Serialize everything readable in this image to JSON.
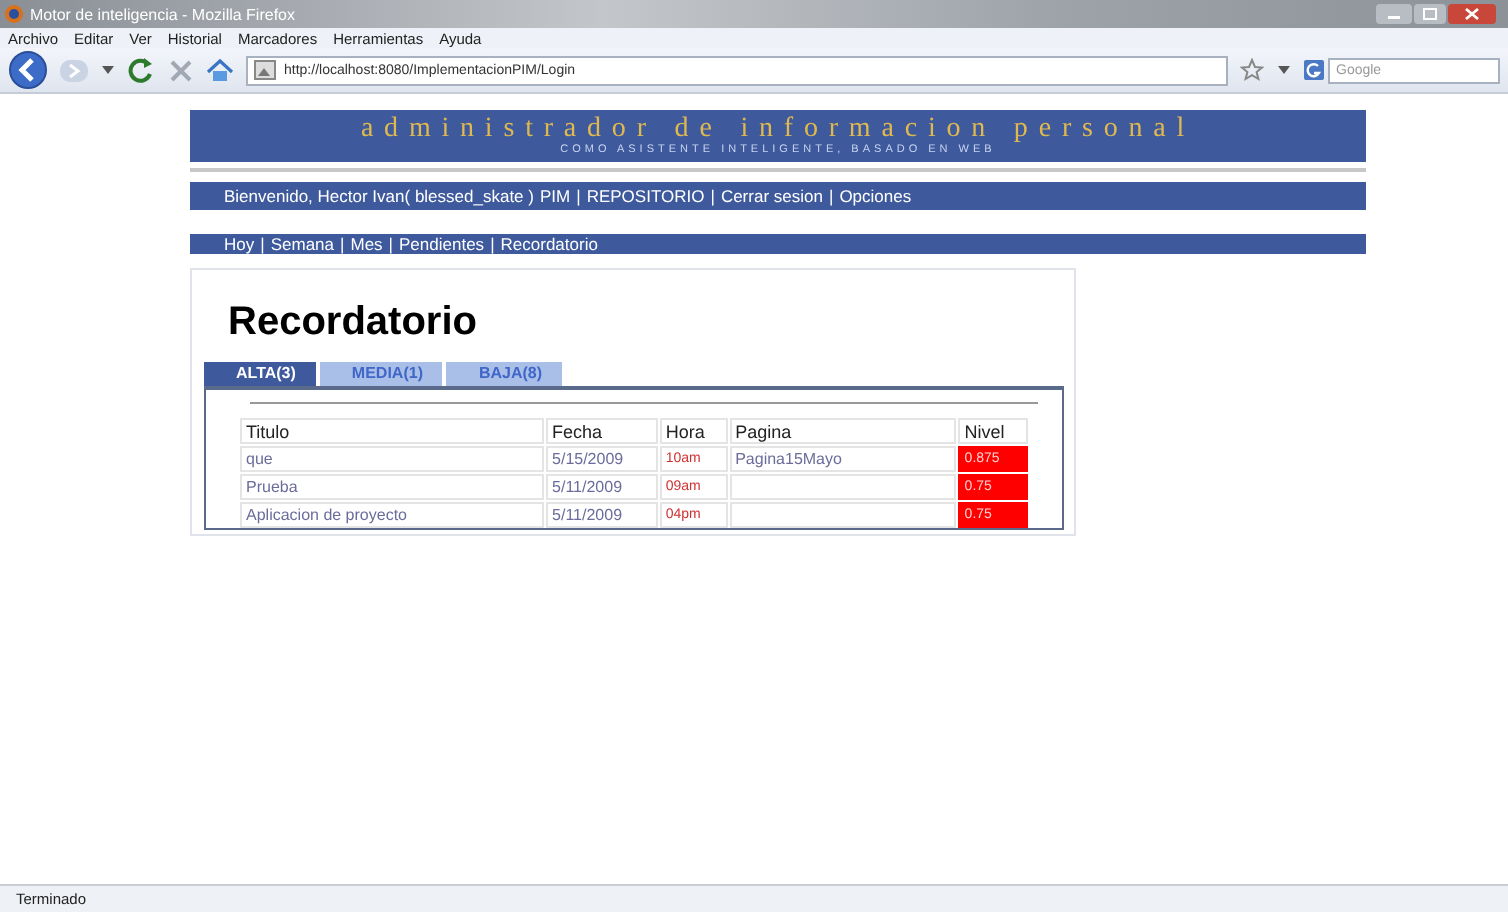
{
  "window": {
    "title": "Motor de inteligencia - Mozilla Firefox"
  },
  "menu": [
    "Archivo",
    "Editar",
    "Ver",
    "Historial",
    "Marcadores",
    "Herramientas",
    "Ayuda"
  ],
  "navigation": {
    "url": "http://localhost:8080/ImplementacionPIM/Login",
    "search_placeholder": "Google"
  },
  "page": {
    "banner": {
      "title": "administrador de informacion personal",
      "subtitle": "COMO ASISTENTE INTELIGENTE, BASADO EN WEB"
    },
    "user_bar": {
      "greeting": "Bienvenido, Hector Ivan( blessed_skate )",
      "links": [
        "PIM",
        "REPOSITORIO",
        "Cerrar sesion",
        "Opciones"
      ],
      "separator": "|"
    },
    "view_bar": {
      "links": [
        "Hoy",
        "Semana",
        "Mes",
        "Pendientes",
        "Recordatorio"
      ],
      "separator": "|"
    },
    "heading": "Recordatorio",
    "tabs": [
      {
        "label": "ALTA(3)",
        "selected": true
      },
      {
        "label": "MEDIA(1)",
        "selected": false
      },
      {
        "label": "BAJA(8)",
        "selected": false
      }
    ],
    "table": {
      "columns": [
        "Titulo",
        "Fecha",
        "Hora",
        "Pagina",
        "Nivel"
      ],
      "rows": [
        {
          "titulo": "que",
          "fecha": "5/15/2009",
          "hora": "10am",
          "pagina": "Pagina15Mayo",
          "nivel": "0.875"
        },
        {
          "titulo": "Prueba",
          "fecha": "5/11/2009",
          "hora": "09am",
          "nivel": "0.75"
        },
        {
          "titulo": "Aplicacion de proyecto",
          "fecha": "5/11/2009",
          "hora": "04pm",
          "nivel": "0.75"
        }
      ]
    }
  },
  "status_bar": {
    "text": "Terminado"
  }
}
